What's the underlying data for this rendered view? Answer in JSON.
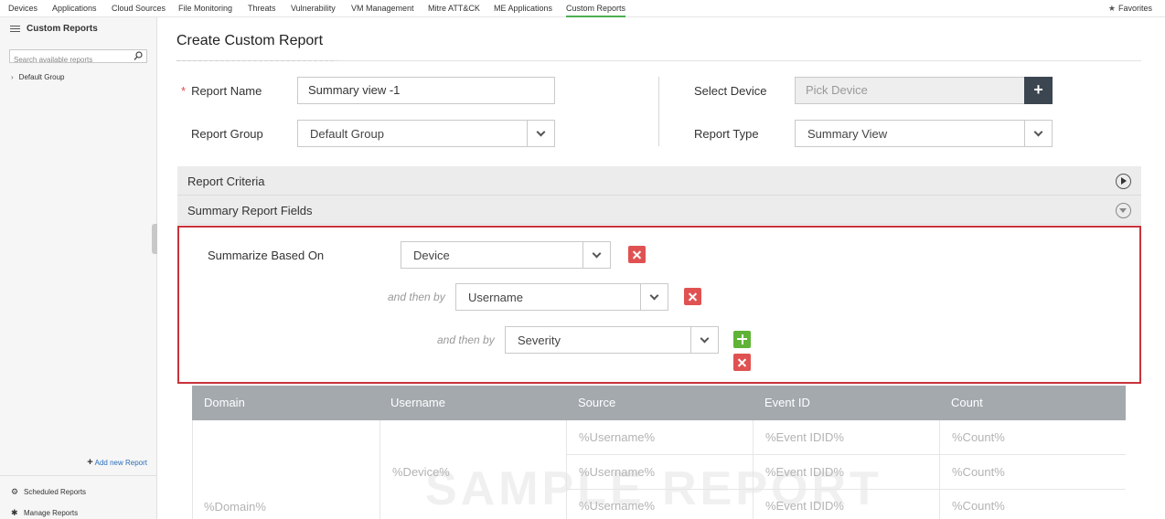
{
  "top_nav": {
    "tabs": [
      "Devices",
      "Applications",
      "Cloud Sources",
      "File Monitoring",
      "Threats",
      "Vulnerability",
      "VM Management",
      "Mitre ATT&CK",
      "ME Applications",
      "Custom Reports"
    ],
    "active_tab": "Custom Reports",
    "favorites_label": "Favorites"
  },
  "sidebar": {
    "title": "Custom Reports",
    "search_placeholder": "Search available reports",
    "group": "Default Group",
    "add_new_report": "Add new Report",
    "scheduled_reports": "Scheduled Reports",
    "manage_reports": "Manage Reports"
  },
  "main": {
    "title": "Create Custom Report",
    "form": {
      "required_mark": "*",
      "report_name_label": "Report Name",
      "report_name_value": "Summary view -1",
      "report_group_label": "Report Group",
      "report_group_value": "Default Group",
      "select_device_label": "Select Device",
      "select_device_placeholder": "Pick Device",
      "report_type_label": "Report Type",
      "report_type_value": "Summary View"
    },
    "sections": {
      "criteria": "Report Criteria",
      "summary_fields": "Summary Report Fields"
    },
    "summary": {
      "based_on_label": "Summarize Based On",
      "based_on_value": "Device",
      "then_by_label": "and then by",
      "then_by_1": "Username",
      "then_by_2": "Severity"
    },
    "sample_table": {
      "columns": [
        "Domain",
        "Username",
        "Source",
        "Event ID",
        "Count"
      ],
      "domain_cell": "%Domain%",
      "username_cell": "%Device%",
      "rows": [
        {
          "source": "%Username%",
          "event_id": "%Event IDID%",
          "count": "%Count%"
        },
        {
          "source": "%Username%",
          "event_id": "%Event IDID%",
          "count": "%Count%"
        },
        {
          "source": "%Username%",
          "event_id": "%Event IDID%",
          "count": "%Count%"
        }
      ],
      "watermark": "SAMPLE REPORT"
    }
  },
  "colors": {
    "accent_green": "#4caf50",
    "highlight_red": "#c8323c",
    "delete_red": "#e05252",
    "add_green": "#5fb336",
    "dark_button": "#3b4650",
    "table_header": "#a4a9ae"
  },
  "icons": [
    "hamburger-icon",
    "search-icon",
    "chevron-right-icon",
    "plus-icon",
    "gear-icon",
    "star-icon",
    "play-circle-icon",
    "chevron-down-circle-icon",
    "close-icon"
  ]
}
